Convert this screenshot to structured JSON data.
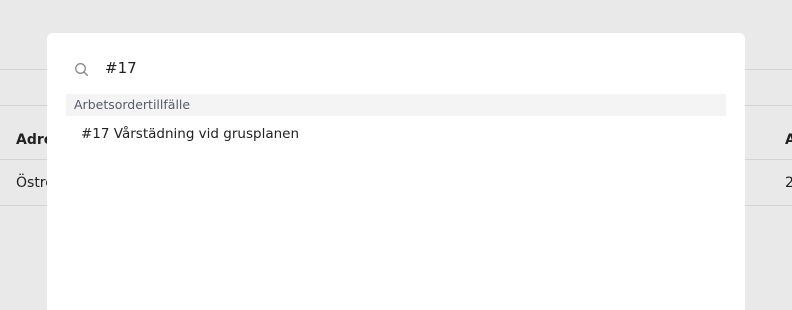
{
  "background": {
    "table": {
      "header_left": "Adre",
      "header_right": "A",
      "row_left": "Östre",
      "row_right": "2"
    }
  },
  "search": {
    "value": "#17",
    "placeholder": ""
  },
  "results": {
    "group_label": "Arbetsordertillfälle",
    "items": [
      {
        "label": "#17 Vårstädning vid grusplanen"
      }
    ]
  }
}
